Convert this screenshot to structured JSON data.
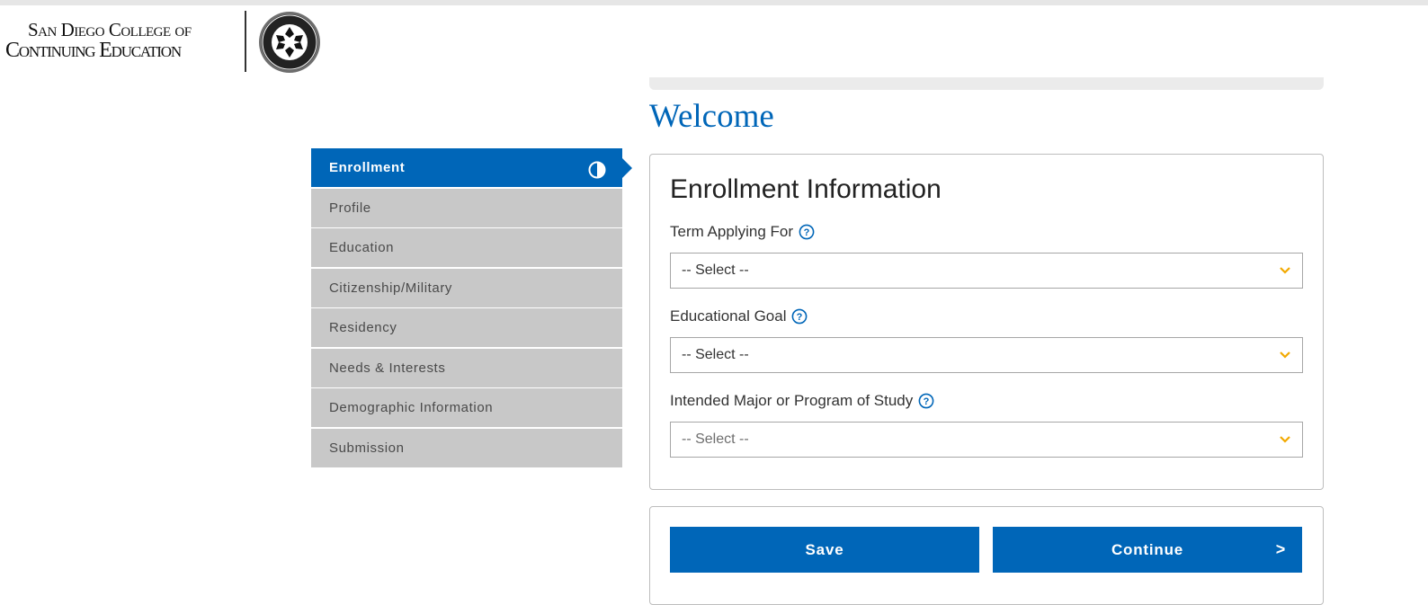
{
  "logo": {
    "line1": "San Diego College of",
    "line2": "Continuing Education",
    "seal_icon": "college-seal-icon"
  },
  "sidebar": {
    "items": [
      {
        "label": "Enrollment",
        "active": true,
        "icon": "contrast-half-circle-icon"
      },
      {
        "label": "Profile"
      },
      {
        "label": "Education"
      },
      {
        "label": "Citizenship/Military"
      },
      {
        "label": "Residency"
      },
      {
        "label": "Needs & Interests"
      },
      {
        "label": "Demographic Information"
      },
      {
        "label": "Submission"
      }
    ]
  },
  "main": {
    "heading": "Welcome",
    "card_title": "Enrollment Information",
    "fields": [
      {
        "label": "Term Applying For",
        "value": "-- Select --"
      },
      {
        "label": "Educational Goal",
        "value": "-- Select --"
      },
      {
        "label": "Intended Major or Program of Study",
        "value": "-- Select --"
      }
    ]
  },
  "actions": {
    "save_label": "Save",
    "continue_label": "Continue",
    "continue_arrow": ">"
  },
  "colors": {
    "primary": "#0066b8",
    "nav_inactive": "#c8c8c8",
    "chevron": "#f2a900"
  }
}
